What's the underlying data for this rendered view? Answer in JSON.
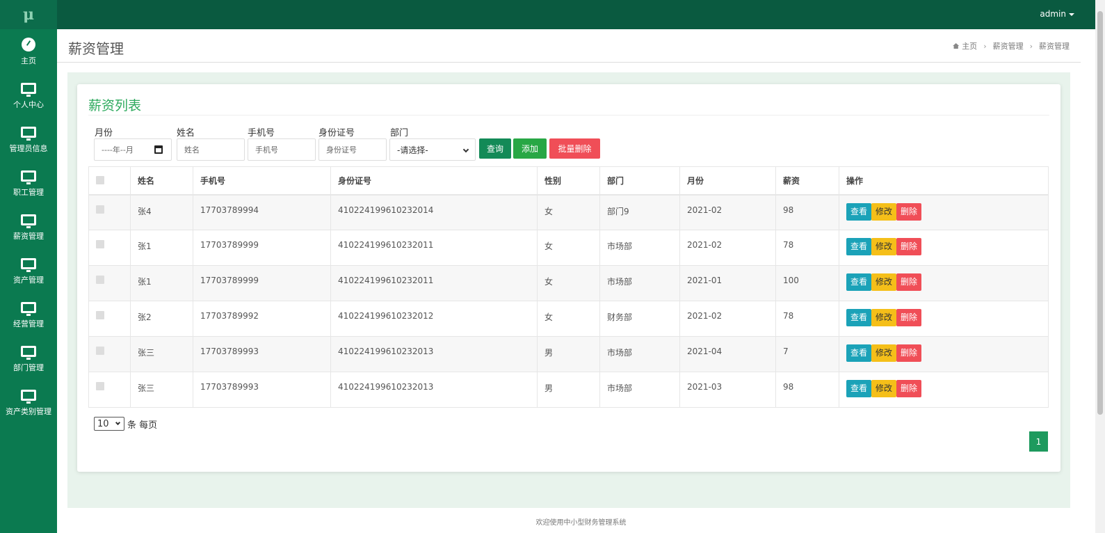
{
  "app": {
    "logo_text": "μ",
    "user": "admin"
  },
  "sidebar": {
    "items": [
      {
        "label": "主页",
        "icon": "dashboard-icon"
      },
      {
        "label": "个人中心",
        "icon": "monitor-icon"
      },
      {
        "label": "管理员信息",
        "icon": "monitor-icon"
      },
      {
        "label": "职工管理",
        "icon": "monitor-icon"
      },
      {
        "label": "薪资管理",
        "icon": "monitor-icon"
      },
      {
        "label": "资产管理",
        "icon": "monitor-icon"
      },
      {
        "label": "经营管理",
        "icon": "monitor-icon"
      },
      {
        "label": "部门管理",
        "icon": "monitor-icon"
      },
      {
        "label": "资产类别管理",
        "icon": "monitor-icon"
      }
    ]
  },
  "header": {
    "title": "薪资管理",
    "breadcrumb": [
      "主页",
      "薪资管理",
      "薪资管理"
    ]
  },
  "card": {
    "title": "薪资列表",
    "filters": {
      "month_label": "月份",
      "month_value": "----年--月",
      "name_label": "姓名",
      "name_placeholder": "姓名",
      "phone_label": "手机号",
      "phone_placeholder": "手机号",
      "id_label": "身份证号",
      "id_placeholder": "身份证号",
      "dept_label": "部门",
      "dept_value": "-请选择-"
    },
    "buttons": {
      "query": "查询",
      "add": "添加",
      "batch_delete": "批量删除"
    }
  },
  "table": {
    "columns": [
      "姓名",
      "手机号",
      "身份证号",
      "性别",
      "部门",
      "月份",
      "薪资",
      "操作"
    ],
    "actions": {
      "view": "查看",
      "edit": "修改",
      "delete": "删除"
    },
    "rows": [
      {
        "name": "张4",
        "phone": "17703789994",
        "id": "410224199610232014",
        "gender": "女",
        "dept": "部门9",
        "month": "2021-02",
        "salary": "98"
      },
      {
        "name": "张1",
        "phone": "17703789999",
        "id": "410224199610232011",
        "gender": "女",
        "dept": "市场部",
        "month": "2021-02",
        "salary": "78"
      },
      {
        "name": "张1",
        "phone": "17703789999",
        "id": "410224199610232011",
        "gender": "女",
        "dept": "市场部",
        "month": "2021-01",
        "salary": "100"
      },
      {
        "name": "张2",
        "phone": "17703789992",
        "id": "410224199610232012",
        "gender": "女",
        "dept": "财务部",
        "month": "2021-02",
        "salary": "78"
      },
      {
        "name": "张三",
        "phone": "17703789993",
        "id": "410224199610232013",
        "gender": "男",
        "dept": "市场部",
        "month": "2021-04",
        "salary": "7"
      },
      {
        "name": "张三",
        "phone": "17703789993",
        "id": "410224199610232013",
        "gender": "男",
        "dept": "市场部",
        "month": "2021-03",
        "salary": "98"
      }
    ]
  },
  "pagination": {
    "page_size": "10",
    "page_size_suffix": "条 每页",
    "current_page": "1"
  },
  "footer": {
    "text": "欢迎使用中小型财务管理系统"
  }
}
